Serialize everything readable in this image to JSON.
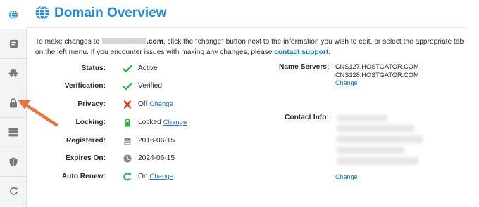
{
  "header": {
    "title": "Domain Overview",
    "icon": "globe-icon"
  },
  "sidebar": {
    "items": [
      {
        "name": "globe",
        "icon": "globe-icon",
        "active": true
      },
      {
        "name": "overview",
        "icon": "card-icon"
      },
      {
        "name": "privacy",
        "icon": "incognito-icon"
      },
      {
        "name": "locking",
        "icon": "lock-icon"
      },
      {
        "name": "dns",
        "icon": "server-icon"
      },
      {
        "name": "security",
        "icon": "shield-icon"
      },
      {
        "name": "renew",
        "icon": "refresh-icon"
      }
    ]
  },
  "intro": {
    "part1": "To make changes to",
    "domain_suffix": ".com",
    "part2": ", click the \"change\" button next to the information you wish to edit, or select the appropriate tab on the left menu. If you encounter issues with making any changes, please",
    "support_link": "contact support",
    "end": "."
  },
  "status_rows": [
    {
      "label": "Status:",
      "value": "Active",
      "icon": "check-icon",
      "color": "#2fb344"
    },
    {
      "label": "Verification:",
      "value": "Verified",
      "icon": "check-icon",
      "color": "#2fb344"
    },
    {
      "label": "Privacy:",
      "value": "Off",
      "change": "Change",
      "icon": "x-icon",
      "color": "#e8321f"
    },
    {
      "label": "Locking:",
      "value": "Locked",
      "change": "Change",
      "icon": "lock-icon",
      "color": "#2fb344"
    },
    {
      "label": "Registered:",
      "value": "2016-06-15",
      "icon": "calendar-icon",
      "color": "#888888"
    },
    {
      "label": "Expires On:",
      "value": "2024-06-15",
      "icon": "clock-icon",
      "color": "#888888"
    },
    {
      "label": "Auto Renew:",
      "value": "On",
      "change": "Change",
      "icon": "refresh-icon",
      "color": "#2fb344"
    }
  ],
  "name_servers": {
    "label": "Name Servers:",
    "values": [
      "CNS127.HOSTGATOR.COM",
      "CNS128.HOSTGATOR.COM"
    ],
    "change": "Change"
  },
  "contact_info": {
    "label": "Contact Info:",
    "change": "Change"
  },
  "colors": {
    "accent": "#1f88d8",
    "link": "#1f6fd1",
    "arrow": "#e8743b"
  }
}
